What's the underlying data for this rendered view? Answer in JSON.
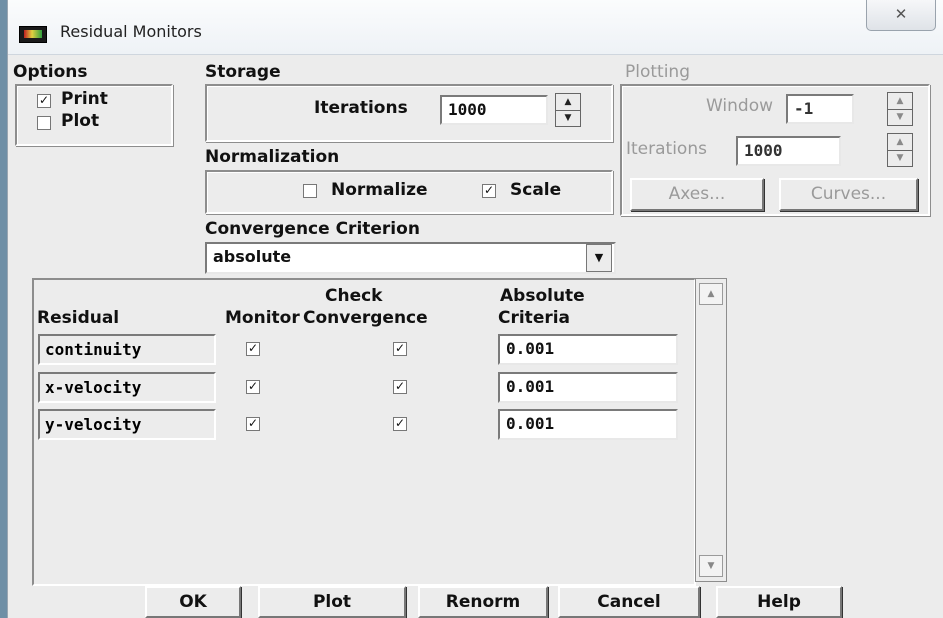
{
  "window": {
    "title": "Residual Monitors",
    "close_glyph": "✕"
  },
  "options": {
    "heading": "Options",
    "print": {
      "label": "Print",
      "checked": true
    },
    "plot": {
      "label": "Plot",
      "checked": false
    }
  },
  "storage": {
    "heading": "Storage",
    "iterations_label": "Iterations",
    "iterations_value": "1000"
  },
  "normalization": {
    "heading": "Normalization",
    "normalize": {
      "label": "Normalize",
      "checked": false
    },
    "scale": {
      "label": "Scale",
      "checked": true
    }
  },
  "convergence": {
    "heading": "Convergence Criterion",
    "selected": "absolute"
  },
  "plotting": {
    "heading": "Plotting",
    "window_label": "Window",
    "window_value": "-1",
    "iterations_label": "Iterations",
    "iterations_value": "1000",
    "axes_button": "Axes...",
    "curves_button": "Curves..."
  },
  "table": {
    "col_residual": "Residual",
    "col_monitor": "Monitor",
    "col_check_line1": "Check",
    "col_check_line2": "Convergence",
    "col_abs_line1": "Absolute",
    "col_abs_line2": "Criteria",
    "rows": [
      {
        "name": "continuity",
        "monitor": true,
        "check": true,
        "criteria": "0.001"
      },
      {
        "name": "x-velocity",
        "monitor": true,
        "check": true,
        "criteria": "0.001"
      },
      {
        "name": "y-velocity",
        "monitor": true,
        "check": true,
        "criteria": "0.001"
      }
    ]
  },
  "buttons": {
    "ok": "OK",
    "plot": "Plot",
    "renorm": "Renorm",
    "cancel": "Cancel",
    "help": "Help"
  },
  "glyphs": {
    "check": "✓",
    "arrow_up": "▲",
    "arrow_down": "▼"
  }
}
